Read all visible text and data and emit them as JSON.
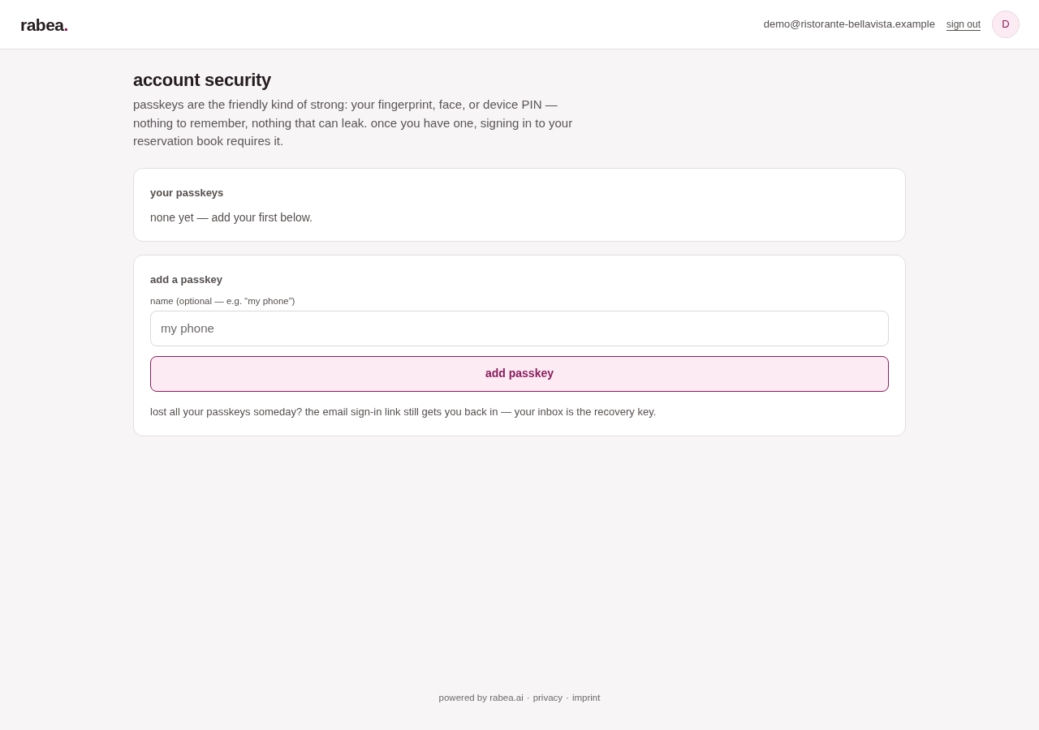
{
  "header": {
    "logo": {
      "text": "rabea",
      "accent": "."
    },
    "email": "demo@ristorante-bellavista.example",
    "sign_out": "sign out",
    "avatar": "D"
  },
  "page": {
    "title": "account security",
    "intro": "passkeys are the friendly kind of strong: your fingerprint, face, or device PIN — nothing to remember, nothing that can leak. once you have one, signing in to your reservation book requires it."
  },
  "passkeys_card": {
    "title": "your passkeys",
    "empty_text": "none yet — add your first below."
  },
  "add_card": {
    "title": "add a passkey",
    "field": {
      "label": "name (optional — e.g. “my phone”)",
      "placeholder": "my phone"
    },
    "button": "add passkey",
    "note": "lost all your passkeys someday? the email sign-in link still gets you back in — your inbox is the recovery key."
  },
  "footer": {
    "links": [
      "powered by rabea.ai",
      "privacy",
      "imprint"
    ],
    "separator": "·"
  }
}
